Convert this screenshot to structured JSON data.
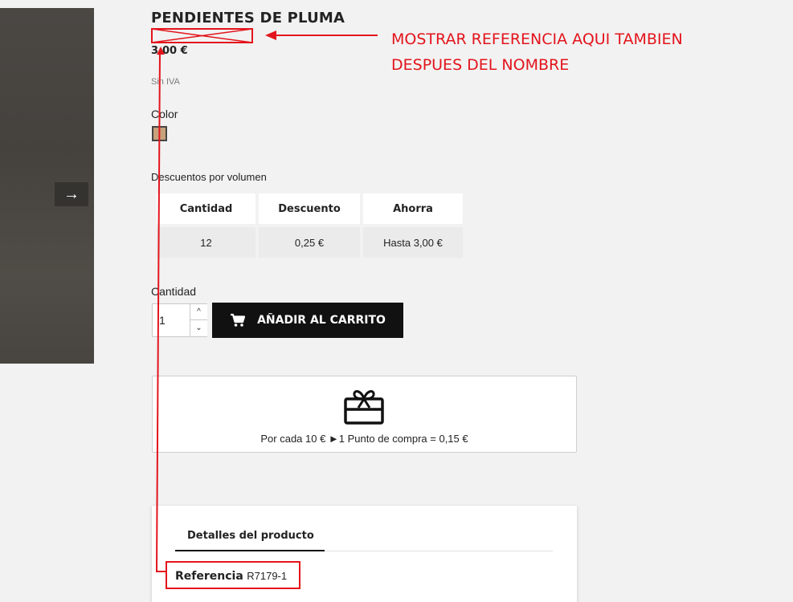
{
  "gallery": {
    "next_icon": "arrow-right-icon",
    "next_glyph": "→"
  },
  "product": {
    "title": "PENDIENTES DE PLUMA",
    "price": "3,00 €",
    "tax_label": "Sin IVA",
    "color_label": "Color",
    "swatch_color": "#c7a27c"
  },
  "volume_discounts": {
    "label": "Descuentos por volumen",
    "headers": [
      "Cantidad",
      "Descuento",
      "Ahorra"
    ],
    "rows": [
      [
        "12",
        "0,25 €",
        "Hasta 3,00 €"
      ]
    ]
  },
  "quantity": {
    "label": "Cantidad",
    "value": "1",
    "up_glyph": "^",
    "down_glyph": "⌄"
  },
  "add_to_cart": {
    "label": "AÑADIR AL CARRITO",
    "icon": "cart-icon"
  },
  "loyalty": {
    "icon": "gift-card-icon",
    "text": "Por cada 10 € ►1 Punto de compra = 0,15 €"
  },
  "details": {
    "tab_label": "Detalles del producto",
    "reference_label": "Referencia",
    "reference_value": "R7179-1"
  },
  "annotation": {
    "line1": "MOSTRAR REFERENCIA AQUI TAMBIEN",
    "line2": "DESPUES DEL NOMBRE",
    "color": "#e3141c"
  }
}
